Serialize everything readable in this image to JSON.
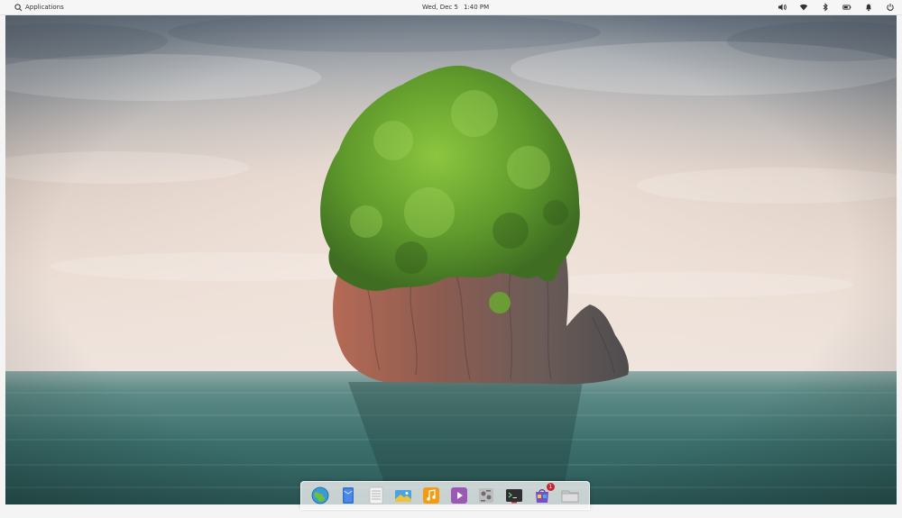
{
  "panel": {
    "applications_label": "Applications",
    "date": "Wed, Dec 5",
    "time": "1:40 PM",
    "indicators": [
      {
        "name": "volume-icon"
      },
      {
        "name": "wifi-icon"
      },
      {
        "name": "bluetooth-icon"
      },
      {
        "name": "battery-icon"
      },
      {
        "name": "notifications-icon"
      },
      {
        "name": "power-icon"
      }
    ]
  },
  "dock": {
    "items": [
      {
        "name": "web-browser",
        "icon": "globe-icon",
        "color": "#3a9bd9"
      },
      {
        "name": "mail",
        "icon": "mail-icon",
        "color": "#2e6fd1"
      },
      {
        "name": "calendar",
        "icon": "calendar-icon",
        "color": "#e8e8e8"
      },
      {
        "name": "photos",
        "icon": "photos-icon",
        "color": "#4aa3df"
      },
      {
        "name": "music",
        "icon": "music-icon",
        "color": "#f39c12"
      },
      {
        "name": "videos",
        "icon": "video-icon",
        "color": "#9b59b6"
      },
      {
        "name": "settings",
        "icon": "settings-icon",
        "color": "#b0b0b0"
      },
      {
        "name": "terminal",
        "icon": "terminal-icon",
        "color": "#333333"
      },
      {
        "name": "app-center",
        "icon": "appcenter-icon",
        "color": "#7a4fc4",
        "badge": "1"
      },
      {
        "name": "files",
        "icon": "files-icon",
        "color": "#c8c8c8"
      }
    ]
  },
  "colors": {
    "sky_top": "#6f7d8d",
    "sky_bottom": "#eadcd2",
    "sea": "#3d7773",
    "foliage": "#5e9b2c",
    "rock": "#8a5a4e"
  }
}
